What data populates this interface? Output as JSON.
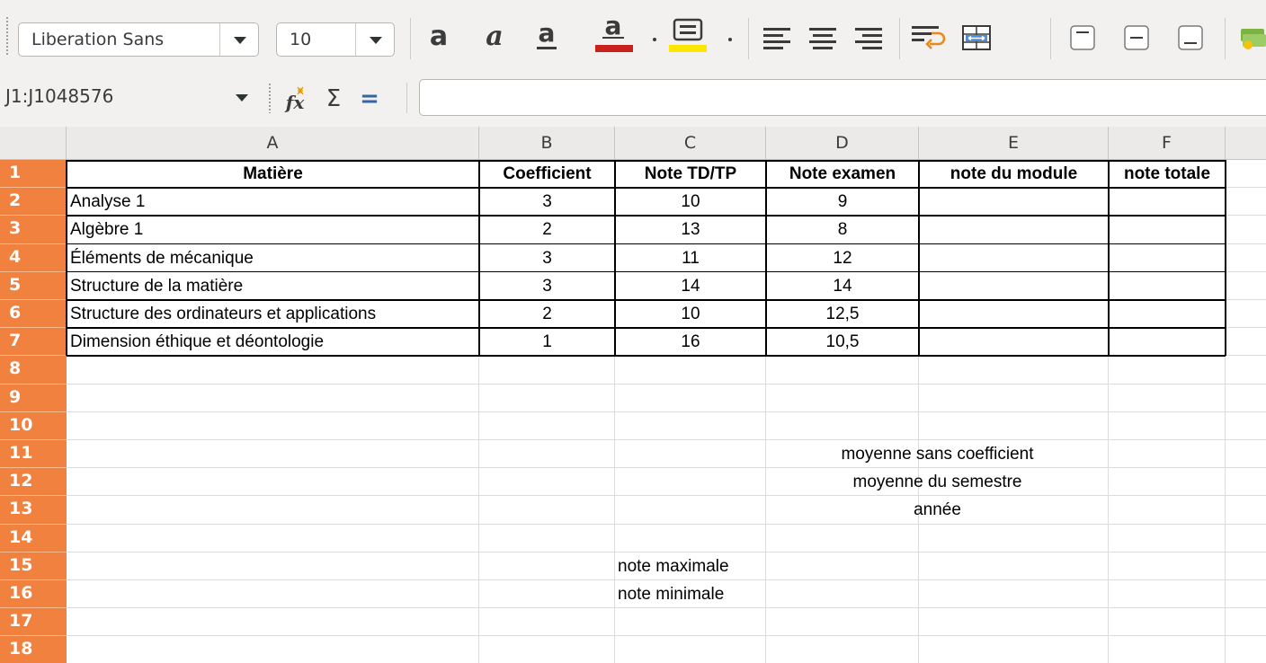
{
  "toolbar": {
    "font_name": "Liberation Sans",
    "font_size": "10",
    "font_color": "#c9211e",
    "highlight_color": "#ffe600",
    "icons": [
      "bold-icon",
      "italic-icon",
      "underline-icon",
      "font-color-icon",
      "highlight-icon",
      "align-left-icon",
      "align-center-icon",
      "align-right-icon",
      "wrap-text-icon",
      "merge-cells-icon",
      "align-top-icon",
      "center-vertically-icon",
      "align-bottom-icon",
      "currency-icon"
    ]
  },
  "formula_bar": {
    "name_box": "J1:J1048576",
    "function_wizard_icon": "fx",
    "sum_icon": "Σ",
    "formula_icon": "=",
    "input_value": ""
  },
  "sheet": {
    "columns": [
      "A",
      "B",
      "C",
      "D",
      "E",
      "F"
    ],
    "rows": [
      "1",
      "2",
      "3",
      "4",
      "5",
      "6",
      "7",
      "8",
      "9",
      "10",
      "11",
      "12",
      "13",
      "14",
      "15",
      "16",
      "17",
      "18"
    ],
    "headers": [
      "Matière",
      "Coefficient",
      "Note TD/TP",
      "Note examen",
      "note du module",
      "note totale"
    ],
    "table": [
      {
        "matiere": "Analyse 1",
        "coef": "3",
        "td": "10",
        "exam": "9"
      },
      {
        "matiere": "Algèbre 1",
        "coef": "2",
        "td": "13",
        "exam": "8"
      },
      {
        "matiere": "Éléments de mécanique",
        "coef": "3",
        "td": "11",
        "exam": "12"
      },
      {
        "matiere": "Structure de la matière",
        "coef": "3",
        "td": "14",
        "exam": "14"
      },
      {
        "matiere": "Structure des ordinateurs et applications",
        "coef": "2",
        "td": "10",
        "exam": "12,5"
      },
      {
        "matiere": "Dimension éthique et déontologie",
        "coef": "1",
        "td": "16",
        "exam": "10,5"
      }
    ],
    "labels": {
      "moyenne_sans_coef": "moyenne sans coefficient",
      "moyenne_semestre": "moyenne du semestre",
      "annee": "année",
      "note_max": "note maximale",
      "note_min": "note minimale"
    },
    "accent_color": "#f0813f"
  }
}
